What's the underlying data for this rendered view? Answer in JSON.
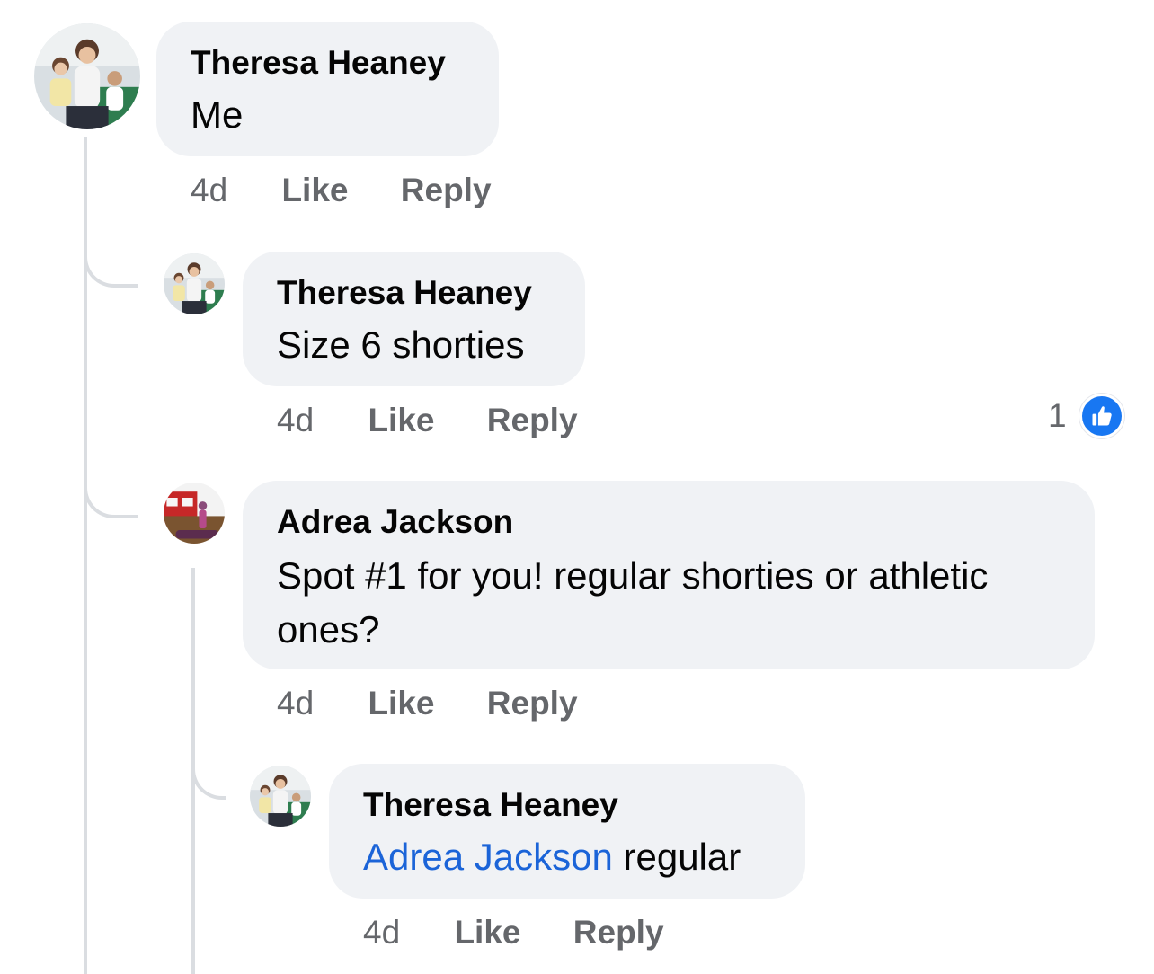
{
  "comments": [
    {
      "author": "Theresa Heaney",
      "text": "Me",
      "time": "4d",
      "like_label": "Like",
      "reply_label": "Reply"
    },
    {
      "author": "Theresa Heaney",
      "text": "Size 6 shorties",
      "time": "4d",
      "like_label": "Like",
      "reply_label": "Reply",
      "reaction_count": "1"
    },
    {
      "author": "Adrea Jackson",
      "text": "Spot #1 for you! regular shorties or athletic ones?",
      "time": "4d",
      "like_label": "Like",
      "reply_label": "Reply"
    },
    {
      "author": "Theresa Heaney",
      "mention": "Adrea Jackson",
      "text": "regular",
      "time": "4d",
      "like_label": "Like",
      "reply_label": "Reply"
    }
  ],
  "colors": {
    "bubble": "#f0f2f5",
    "meta_text": "#65676b",
    "mention": "#1b64d8",
    "like_badge": "#1877f2",
    "thread_line": "#dadde1"
  },
  "icons": {
    "reaction": "thumbs-up-icon"
  }
}
